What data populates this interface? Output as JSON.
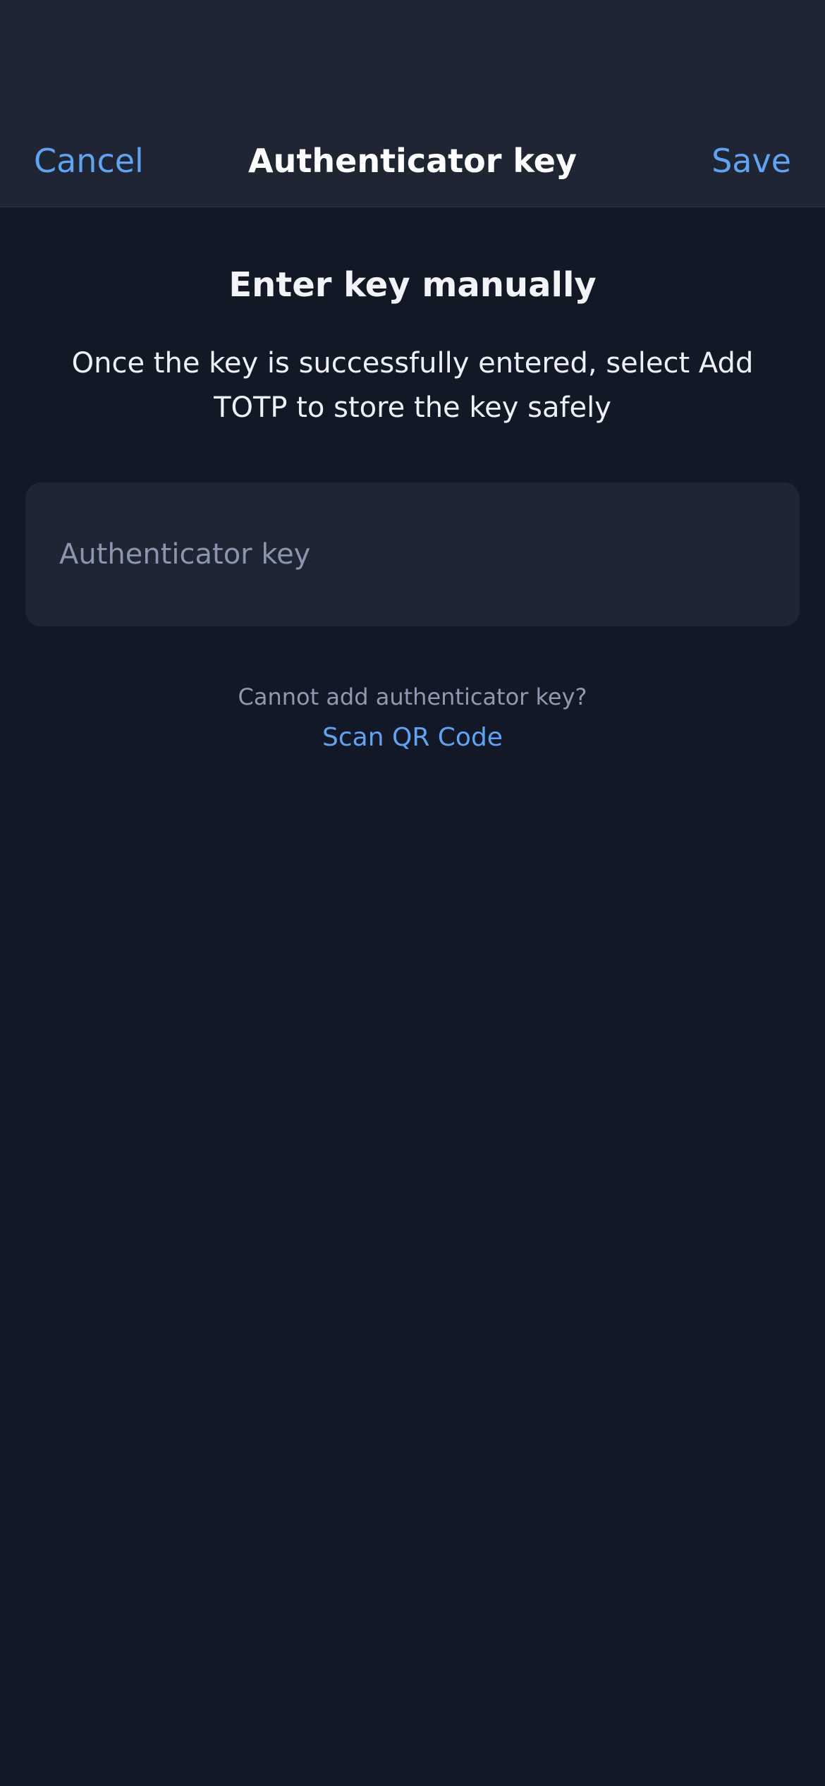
{
  "header": {
    "cancel_label": "Cancel",
    "title": "Authenticator key",
    "save_label": "Save"
  },
  "main": {
    "heading": "Enter key manually",
    "description": "Once the key is successfully entered, select Add TOTP to store the key safely",
    "key_field": {
      "value": "",
      "placeholder": "Authenticator key"
    },
    "hint": "Cannot add authenticator key?",
    "scan_link_label": "Scan QR Code"
  },
  "colors": {
    "background": "#121826",
    "surface": "#1f2532",
    "accent": "#5ea4f4",
    "muted_text": "#8f9ab0"
  }
}
